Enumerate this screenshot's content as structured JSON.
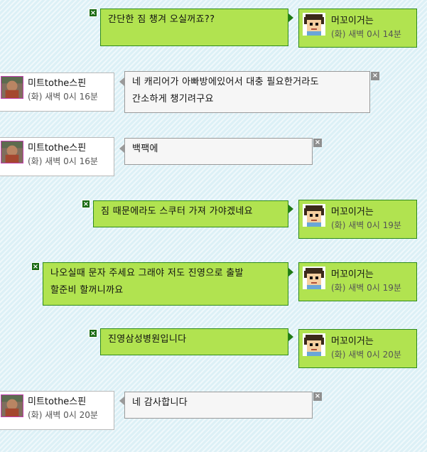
{
  "users": {
    "me": {
      "name": "머꼬이거는",
      "avatar_icon": "pixel-boy-avatar-icon"
    },
    "other": {
      "name": "미트tothe스핀",
      "avatar_icon": "photo-avatar-icon"
    }
  },
  "delete_icon_glyph": "×",
  "messages": [
    {
      "side": "right",
      "text_lines": [
        "간단한 짐 챙겨 오실꺼죠??"
      ],
      "time": "(화) 새벽 0시 14분"
    },
    {
      "side": "left",
      "text_lines": [
        "네 캐리어가 아빠방에있어서 대충 필요한거라도",
        "간소하게 챙기려구요"
      ],
      "time": "(화) 새벽 0시 16분"
    },
    {
      "side": "left",
      "text_lines": [
        "백팩에"
      ],
      "time": "(화) 새벽 0시 16분"
    },
    {
      "side": "right",
      "text_lines": [
        "짐 때문에라도 스쿠터 가져 가야겠네요"
      ],
      "time": "(화) 새벽 0시 19분"
    },
    {
      "side": "right",
      "text_lines": [
        "나오실때 문자 주세요 그래야 저도 진영으로 출발",
        "할준비 할꺼니까요"
      ],
      "time": "(화) 새벽 0시 19분"
    },
    {
      "side": "right",
      "text_lines": [
        "진영삼성병원입니다"
      ],
      "time": "(화) 새벽 0시 20분"
    },
    {
      "side": "left",
      "text_lines": [
        "네 감사합니다"
      ],
      "time": "(화) 새벽 0시 20분"
    }
  ]
}
